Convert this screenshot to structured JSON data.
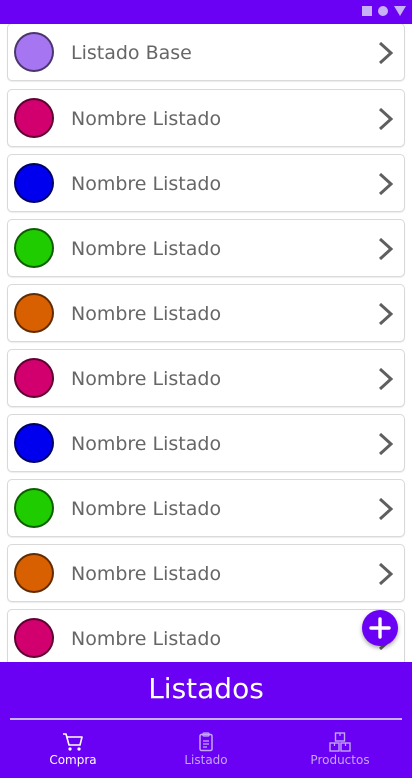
{
  "colors": {
    "accent": "#6a00f4",
    "purple": "#a675f2",
    "magenta": "#d1006e",
    "blue": "#0000ee",
    "green": "#1fcc00",
    "orange": "#d86000"
  },
  "list": {
    "items": [
      {
        "label": "Listado Base",
        "color": "#a675f2",
        "icon": "chevron-right-icon"
      },
      {
        "label": "Nombre Listado",
        "color": "#d1006e",
        "icon": "chevron-right-icon"
      },
      {
        "label": "Nombre Listado",
        "color": "#0000ee",
        "icon": "chevron-right-icon"
      },
      {
        "label": "Nombre Listado",
        "color": "#1fcc00",
        "icon": "chevron-right-icon"
      },
      {
        "label": "Nombre Listado",
        "color": "#d86000",
        "icon": "chevron-right-icon"
      },
      {
        "label": "Nombre Listado",
        "color": "#d1006e",
        "icon": "chevron-right-icon"
      },
      {
        "label": "Nombre Listado",
        "color": "#0000ee",
        "icon": "chevron-right-icon"
      },
      {
        "label": "Nombre Listado",
        "color": "#1fcc00",
        "icon": "chevron-right-icon"
      },
      {
        "label": "Nombre Listado",
        "color": "#d86000",
        "icon": "chevron-right-icon"
      },
      {
        "label": "Nombre Listado",
        "color": "#d1006e",
        "icon": "chevron-right-icon"
      }
    ]
  },
  "fab": {
    "icon": "add-icon"
  },
  "footer": {
    "title": "Listados",
    "nav": [
      {
        "label": "Compra",
        "icon": "cart-icon",
        "active": true
      },
      {
        "label": "Listado",
        "icon": "clipboard-icon",
        "active": false
      },
      {
        "label": "Productos",
        "icon": "boxes-icon",
        "active": false
      }
    ]
  }
}
